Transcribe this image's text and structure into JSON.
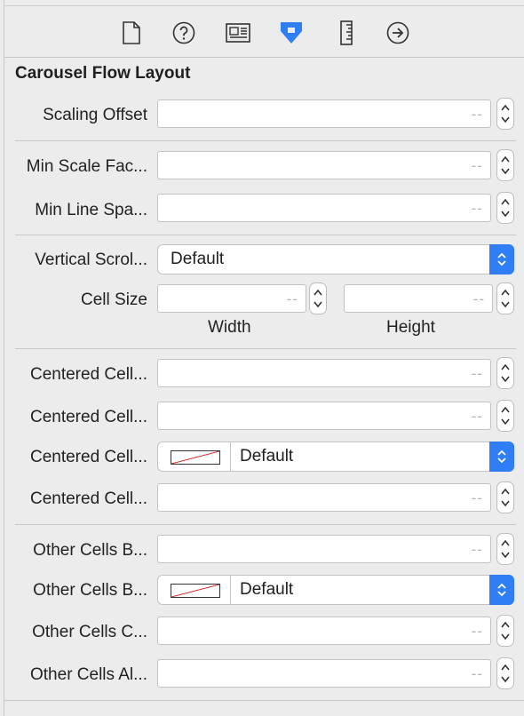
{
  "toolbar": {
    "icons": [
      "file-inspector-icon",
      "quick-help-icon",
      "identity-inspector-icon",
      "attributes-inspector-icon",
      "size-inspector-icon",
      "connections-inspector-icon"
    ],
    "active_icon": "attributes-inspector-icon",
    "accent_color": "#2f7ef6"
  },
  "section": {
    "title": "Carousel Flow Layout"
  },
  "fields": {
    "scaling_offset": {
      "label": "Scaling Offset",
      "value": "--"
    },
    "min_scale_factor": {
      "label": "Min Scale Fac...",
      "value": "--"
    },
    "min_line_spacing": {
      "label": "Min Line Spa...",
      "value": "--"
    },
    "vertical_scroll": {
      "label": "Vertical Scrol...",
      "value": "Default"
    },
    "cell_size": {
      "label": "Cell Size",
      "width_value": "--",
      "height_value": "--",
      "width_label": "Width",
      "height_label": "Height"
    },
    "centered_cell_1": {
      "label": "Centered Cell...",
      "value": "--"
    },
    "centered_cell_2": {
      "label": "Centered Cell...",
      "value": "--"
    },
    "centered_cell_3": {
      "label": "Centered Cell...",
      "value": "Default"
    },
    "centered_cell_4": {
      "label": "Centered Cell...",
      "value": "--"
    },
    "other_cells_1": {
      "label": "Other Cells B...",
      "value": "--"
    },
    "other_cells_2": {
      "label": "Other Cells B...",
      "value": "Default"
    },
    "other_cells_3": {
      "label": "Other Cells C...",
      "value": "--"
    },
    "other_cells_4": {
      "label": "Other Cells Al...",
      "value": "--"
    }
  }
}
